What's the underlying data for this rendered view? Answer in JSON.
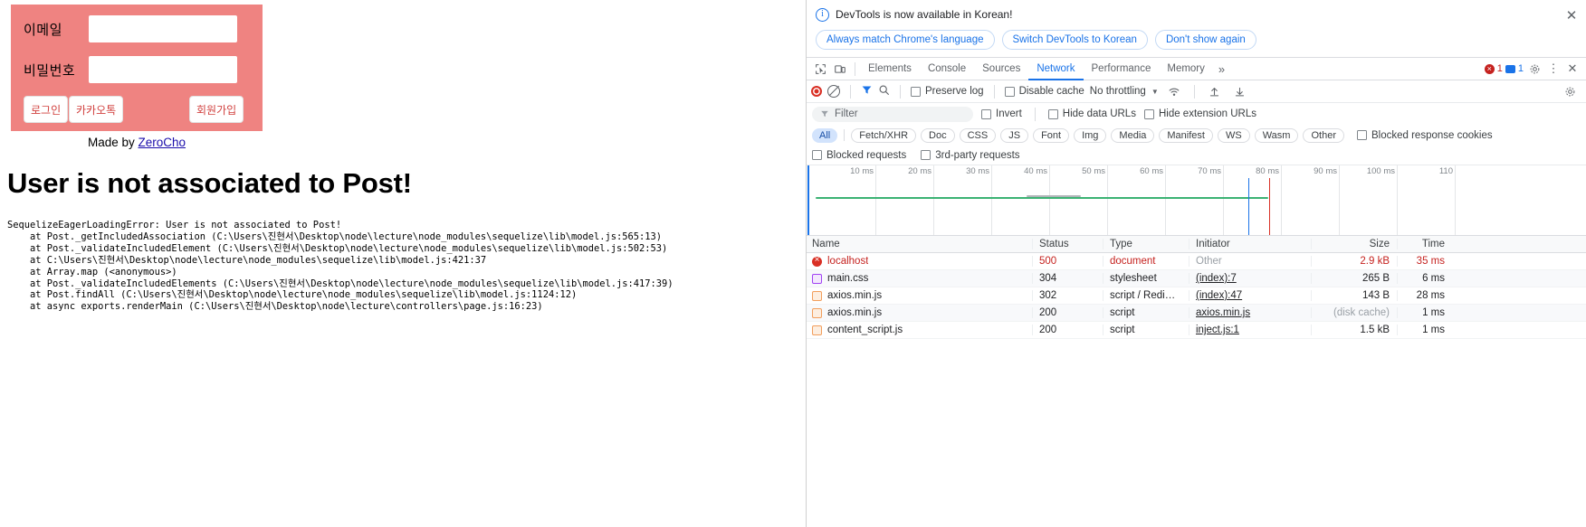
{
  "page": {
    "login": {
      "email_label": "이메일",
      "password_label": "비밀번호",
      "email_value": "",
      "password_value": "",
      "email_placeholder": "",
      "password_placeholder": "",
      "login_button": "로그인",
      "kakao_button": "카카오톡",
      "join_button": "회원가입",
      "bg_color": "#ef8381",
      "button_text_color": "#d1403e"
    },
    "made_by_prefix": "Made by ",
    "made_by_link": "ZeroCho",
    "error_title": "User is not associated to Post!",
    "stack_trace": "SequelizeEagerLoadingError: User is not associated to Post!\n    at Post._getIncludedAssociation (C:\\Users\\진현서\\Desktop\\node\\lecture\\node_modules\\sequelize\\lib\\model.js:565:13)\n    at Post._validateIncludedElement (C:\\Users\\진현서\\Desktop\\node\\lecture\\node_modules\\sequelize\\lib\\model.js:502:53)\n    at C:\\Users\\진현서\\Desktop\\node\\lecture\\node_modules\\sequelize\\lib\\model.js:421:37\n    at Array.map (<anonymous>)\n    at Post._validateIncludedElements (C:\\Users\\진현서\\Desktop\\node\\lecture\\node_modules\\sequelize\\lib\\model.js:417:39)\n    at Post.findAll (C:\\Users\\진현서\\Desktop\\node\\lecture\\node_modules\\sequelize\\lib\\model.js:1124:12)\n    at async exports.renderMain (C:\\Users\\진현서\\Desktop\\node\\lecture\\controllers\\page.js:16:23)"
  },
  "devtools": {
    "banner": {
      "message": "DevTools is now available in Korean!",
      "buttons": [
        "Always match Chrome's language",
        "Switch DevTools to Korean",
        "Don't show again"
      ],
      "close_label": "✕"
    },
    "tabs": [
      {
        "label": "Elements",
        "active": false
      },
      {
        "label": "Console",
        "active": false
      },
      {
        "label": "Sources",
        "active": false
      },
      {
        "label": "Network",
        "active": true
      },
      {
        "label": "Performance",
        "active": false
      },
      {
        "label": "Memory",
        "active": false
      }
    ],
    "tabs_more": "»",
    "error_count": "1",
    "message_count": "1",
    "toolbar": {
      "preserve_log": "Preserve log",
      "disable_cache": "Disable cache",
      "throttling": "No throttling",
      "preserve_log_checked": false,
      "disable_cache_checked": false
    },
    "filter": {
      "placeholder": "Filter",
      "value": "",
      "invert": "Invert",
      "hide_data_urls": "Hide data URLs",
      "hide_extension_urls": "Hide extension URLs"
    },
    "types": [
      "All",
      "Fetch/XHR",
      "Doc",
      "CSS",
      "JS",
      "Font",
      "Img",
      "Media",
      "Manifest",
      "WS",
      "Wasm",
      "Other"
    ],
    "blocked_response_cookies": "Blocked response cookies",
    "blocked_requests": "Blocked requests",
    "third_party_requests": "3rd-party requests",
    "timeline_ticks": [
      "10 ms",
      "20 ms",
      "30 ms",
      "40 ms",
      "50 ms",
      "60 ms",
      "70 ms",
      "80 ms",
      "90 ms",
      "100 ms",
      "110 "
    ],
    "columns": [
      "Name",
      "Status",
      "Type",
      "Initiator",
      "Size",
      "Time"
    ],
    "requests": [
      {
        "name": "localhost",
        "icon": "doc",
        "status": "500",
        "type": "document",
        "initiator": "Other",
        "initiator_link": false,
        "size": "2.9 kB",
        "time": "35 ms",
        "error": true
      },
      {
        "name": "main.css",
        "icon": "css",
        "status": "304",
        "type": "stylesheet",
        "initiator": "(index):7",
        "initiator_link": true,
        "size": "265 B",
        "time": "6 ms",
        "error": false
      },
      {
        "name": "axios.min.js",
        "icon": "js",
        "status": "302",
        "type": "script / Redi…",
        "initiator": "(index):47",
        "initiator_link": true,
        "size": "143 B",
        "time": "28 ms",
        "error": false
      },
      {
        "name": "axios.min.js",
        "icon": "js",
        "status": "200",
        "type": "script",
        "initiator": "axios.min.js",
        "initiator_link": true,
        "size": "(disk cache)",
        "time": "1 ms",
        "error": false
      },
      {
        "name": "content_script.js",
        "icon": "js",
        "status": "200",
        "type": "script",
        "initiator": "inject.js:1",
        "initiator_link": true,
        "size": "1.5 kB",
        "time": "1 ms",
        "error": false
      }
    ]
  }
}
